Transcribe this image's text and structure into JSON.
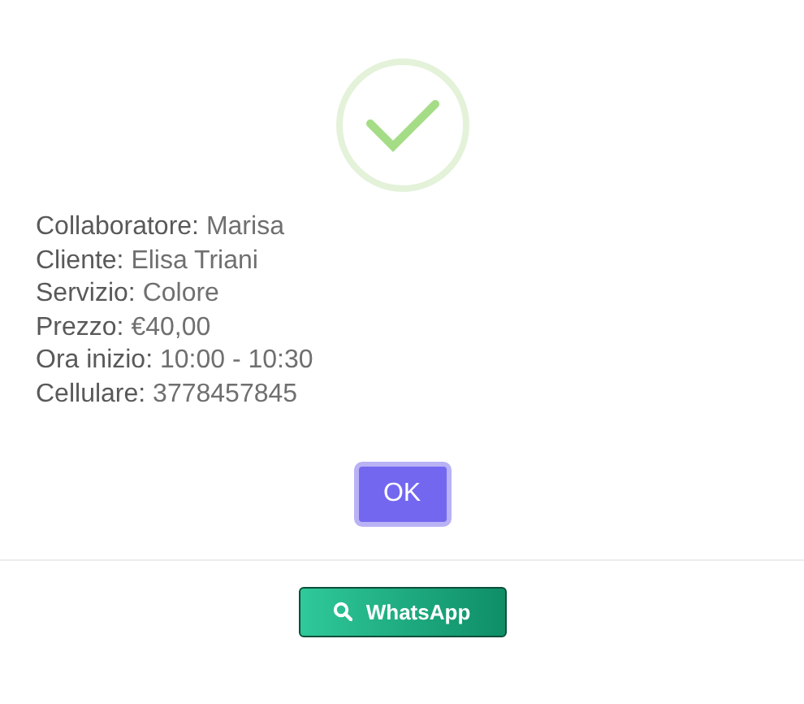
{
  "details": [
    {
      "label": "Collaboratore:",
      "value": "Marisa"
    },
    {
      "label": "Cliente:",
      "value": "Elisa Triani"
    },
    {
      "label": "Servizio:",
      "value": "Colore"
    },
    {
      "label": "Prezzo:",
      "value": "€40,00"
    },
    {
      "label": "Ora inizio:",
      "value": "10:00 - 10:30"
    },
    {
      "label": "Cellulare:",
      "value": "3778457845"
    }
  ],
  "confirm_button": "OK",
  "whatsapp_button": "WhatsApp"
}
